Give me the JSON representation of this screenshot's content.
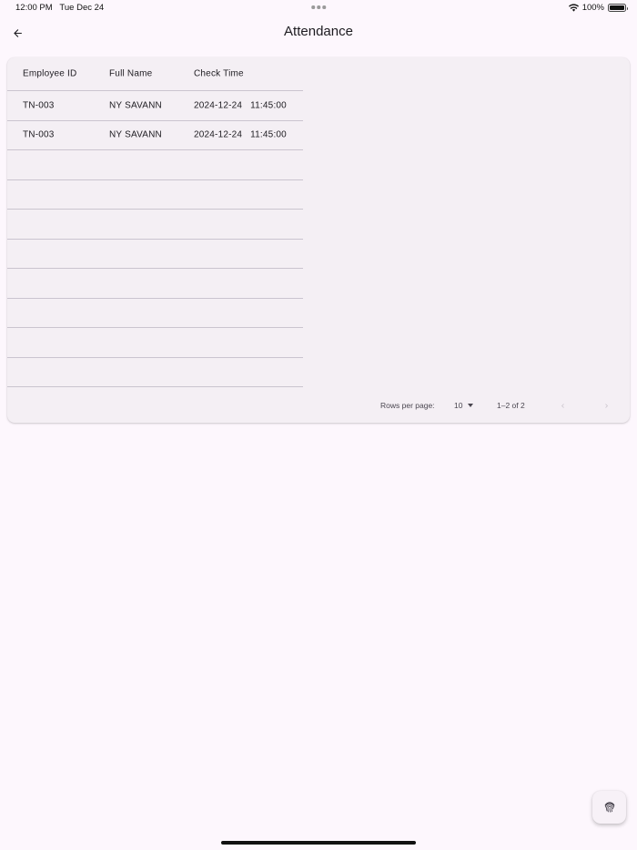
{
  "status_bar": {
    "time": "12:00 PM",
    "date": "Tue Dec 24",
    "battery": "100%",
    "battery_level": 1.0
  },
  "app_bar": {
    "back_icon": "arrow-back-icon",
    "title": "Attendance"
  },
  "table": {
    "columns": [
      "Employee ID",
      "Full Name",
      "Check Time"
    ],
    "rows": [
      {
        "employee_id": "TN-003",
        "full_name": "NY SAVANN",
        "check_date": "2024-12-24",
        "check_time": "11:45:00"
      },
      {
        "employee_id": "TN-003",
        "full_name": "NY SAVANN",
        "check_date": "2024-12-24",
        "check_time": "11:45:00"
      }
    ],
    "empty_rows": 8
  },
  "pagination": {
    "rows_per_page_label": "Rows per page:",
    "rows_per_page_value": "10",
    "range": "1–2 of 2",
    "prev_icon": "chevron-left-icon",
    "next_icon": "chevron-right-icon"
  },
  "fab": {
    "icon": "fingerprint-icon"
  },
  "colors": {
    "background": "#fdf7fd",
    "card": "#f4eff4",
    "divider": "#cac4cf",
    "text": "#1d1b20"
  }
}
